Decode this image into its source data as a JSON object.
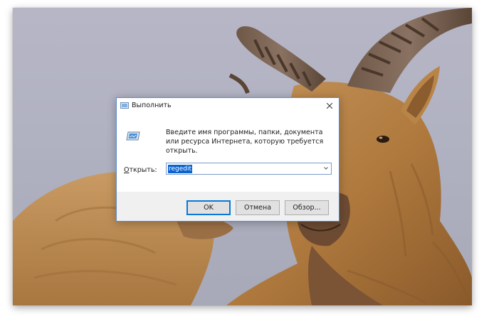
{
  "dialog": {
    "title": "Выполнить",
    "description": "Введите имя программы, папки, документа или ресурса Интернета, которую требуется открыть.",
    "open_label_prefix": "",
    "open_label_underlined": "О",
    "open_label_rest": "ткрыть:",
    "input_value": "regedit",
    "buttons": {
      "ok": "OK",
      "cancel": "Отмена",
      "browse": "Обзор..."
    },
    "icons": {
      "title": "run-icon",
      "close": "close-icon",
      "dropdown": "chevron-down-icon"
    }
  },
  "colors": {
    "accent": "#0a64d0",
    "border": "#5d8ed3",
    "footer": "#f0f0f0"
  }
}
